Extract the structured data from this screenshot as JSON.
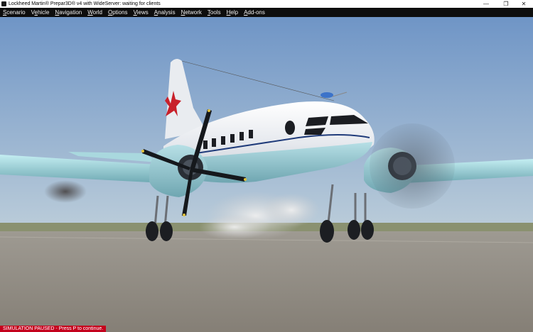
{
  "window": {
    "title": "Lockheed Martin® Prepar3D® v4 with WideServer: waiting for clients",
    "minimize_glyph": "—",
    "maximize_glyph": "❐",
    "close_glyph": "✕"
  },
  "menu": [
    {
      "pre": "",
      "acc": "S",
      "post": "cenario"
    },
    {
      "pre": "V",
      "acc": "e",
      "post": "hicle"
    },
    {
      "pre": "",
      "acc": "N",
      "post": "avigation"
    },
    {
      "pre": "",
      "acc": "W",
      "post": "orld"
    },
    {
      "pre": "",
      "acc": "O",
      "post": "ptions"
    },
    {
      "pre": "",
      "acc": "V",
      "post": "iews"
    },
    {
      "pre": "",
      "acc": "A",
      "post": "nalysis"
    },
    {
      "pre": "",
      "acc": "N",
      "post": "etwork"
    },
    {
      "pre": "",
      "acc": "T",
      "post": "ools"
    },
    {
      "pre": "",
      "acc": "H",
      "post": "elp"
    },
    {
      "pre": "",
      "acc": "A",
      "post": "dd-ons"
    }
  ],
  "status": {
    "text": "SIMULATION PAUSED - Press P to continue.",
    "color": "#c4001c"
  },
  "colors": {
    "sky_top": "#6f95c6",
    "sky_bottom": "#b5c8d8",
    "ground": "#8e8a82",
    "fuselage": "#eef0f4",
    "belly": "#9fcfd8",
    "stripe": "#1f3b7a"
  },
  "icons": {
    "app": "prepar3d-app-icon",
    "minimize": "minimize-icon",
    "maximize": "restore-icon",
    "close": "close-icon"
  }
}
